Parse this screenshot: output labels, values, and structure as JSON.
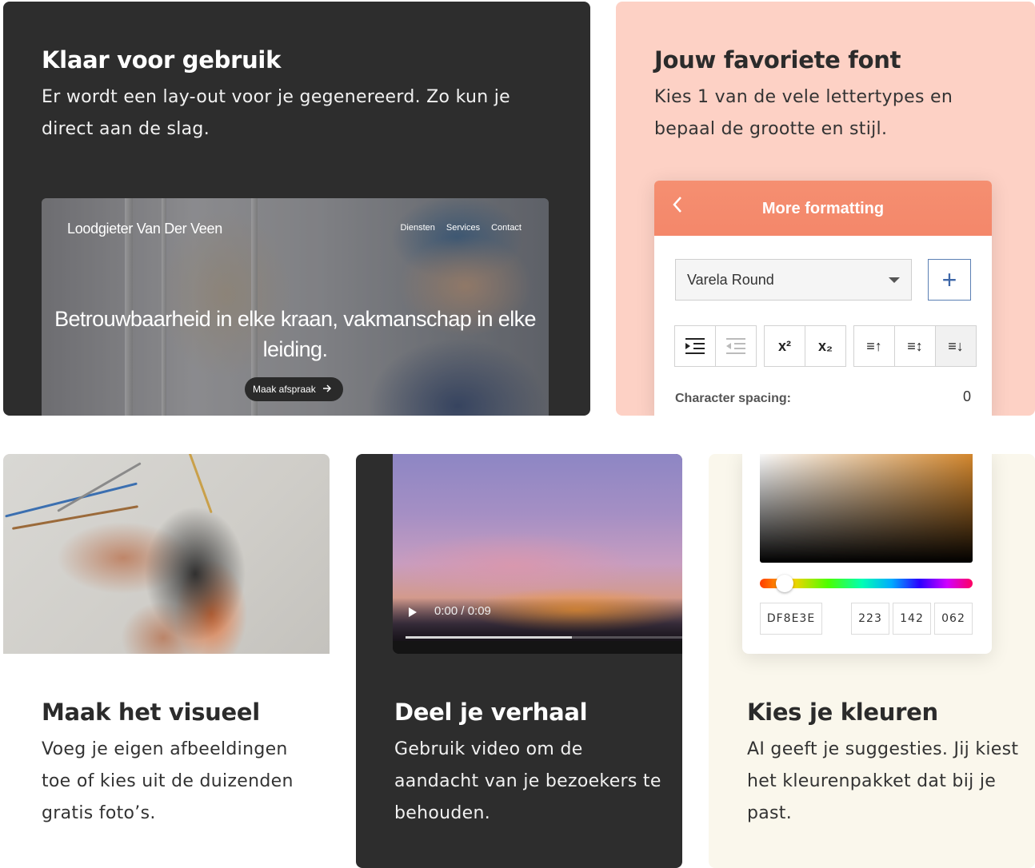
{
  "card_ready": {
    "title": "Klaar voor gebruik",
    "description": "Er wordt een lay-out voor je gegenereerd. Zo kun je direct aan de slag.",
    "site_preview": {
      "logo": "Loodgieter Van Der Veen",
      "nav": [
        "Diensten",
        "Services",
        "Contact"
      ],
      "hero": "Betrouwbaarheid in elke kraan, vakmanschap in elke leiding.",
      "cta": "Maak afspraak",
      "cta_icon": "arrow-right-icon"
    }
  },
  "card_font": {
    "title": "Jouw favoriete font",
    "description": "Kies 1 van de vele lettertypes en bepaal de grootte en stijl.",
    "panel": {
      "back_icon": "chevron-left-icon",
      "title": "More formatting",
      "font_value": "Varela Round",
      "add_label": "+",
      "toolbar": [
        {
          "name": "indent",
          "glyph": "⇥"
        },
        {
          "name": "outdent",
          "glyph": "⇤"
        },
        {
          "name": "superscript",
          "glyph": "x²"
        },
        {
          "name": "subscript",
          "glyph": "x₂"
        },
        {
          "name": "align-top",
          "glyph": "≡↑"
        },
        {
          "name": "align-middle",
          "glyph": "≡↕"
        },
        {
          "name": "align-bottom",
          "glyph": "≡↓"
        }
      ],
      "character_spacing_label": "Character spacing:",
      "character_spacing_value": "0"
    }
  },
  "card_visual": {
    "title": "Maak het visueel",
    "description": "Voeg je eigen afbeeldingen toe of kies uit de duizenden gratis foto’s."
  },
  "card_story": {
    "title": "Deel je verhaal",
    "description": "Gebruik video om de aandacht van je bezoekers te behouden.",
    "video": {
      "time": "0:00 / 0:09",
      "progress": 0.6
    }
  },
  "card_colors": {
    "title": "Kies je kleuren",
    "description": "AI geeft je suggesties. Jij kiest het kleurenpakket dat bij je past.",
    "picker": {
      "hex": "DF8E3E",
      "r": "223",
      "g": "142",
      "b": "062"
    }
  },
  "colors": {
    "dark_card": "#2d2d2d",
    "peach_card": "#fdd1c5",
    "cream_card": "#faf7ec",
    "accent_coral": "#f58f71",
    "accent_blue": "#3e67a8",
    "picked_color": "#DF8E3E"
  }
}
